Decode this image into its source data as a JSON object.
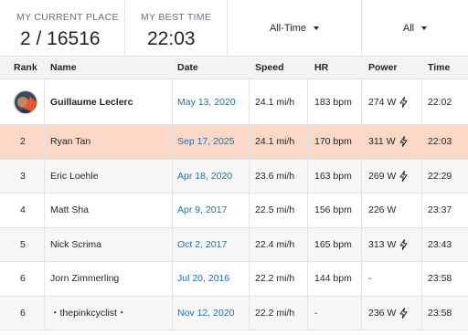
{
  "summary": {
    "current_place_label": "MY CURRENT PLACE",
    "current_place_value": "2 / 16516",
    "best_time_label": "MY BEST TIME",
    "best_time_value": "22:03",
    "time_filter": "All-Time",
    "group_filter": "All"
  },
  "columns": {
    "rank": "Rank",
    "name": "Name",
    "date": "Date",
    "speed": "Speed",
    "hr": "HR",
    "power": "Power",
    "time": "Time"
  },
  "rows": [
    {
      "rank": "",
      "name": "Guillaume Leclerc",
      "date": "May 13, 2020",
      "speed": "24.1 mi/h",
      "hr": "183 bpm",
      "power": "274 W",
      "time": "22:02"
    },
    {
      "rank": "2",
      "name": "Ryan Tan",
      "date": "Sep 17, 2025",
      "speed": "24.1 mi/h",
      "hr": "170 bpm",
      "power": "311 W",
      "time": "22:03"
    },
    {
      "rank": "3",
      "name": "Eric Loehle",
      "date": "Apr 18, 2020",
      "speed": "23.6 mi/h",
      "hr": "163 bpm",
      "power": "269 W",
      "time": "22:29"
    },
    {
      "rank": "4",
      "name": "Matt Sha",
      "date": "Apr 9, 2017",
      "speed": "22.5 mi/h",
      "hr": "156 bpm",
      "power": "226 W",
      "time": "23:37"
    },
    {
      "rank": "5",
      "name": "Nick Scrima",
      "date": "Oct 2, 2017",
      "speed": "22.4 mi/h",
      "hr": "165 bpm",
      "power": "313 W",
      "time": "23:43"
    },
    {
      "rank": "6",
      "name": "Jorn Zimmerling",
      "date": "Jul 20, 2016",
      "speed": "22.2 mi/h",
      "hr": "144 bpm",
      "power": "-",
      "time": "23:58"
    },
    {
      "rank": "6",
      "name": "・thepinkcyclist・",
      "date": "Nov 12, 2020",
      "speed": "22.2 mi/h",
      "hr": "-",
      "power": "236 W",
      "time": "23:58"
    }
  ],
  "icons": {
    "power_estimated": "lightning-bolt-icon",
    "rank_one": "crown-avatar-icon",
    "dropdown": "caret-down-icon"
  },
  "colors": {
    "highlight_row": "#f9d8c8",
    "link": "#1f6ea8"
  }
}
